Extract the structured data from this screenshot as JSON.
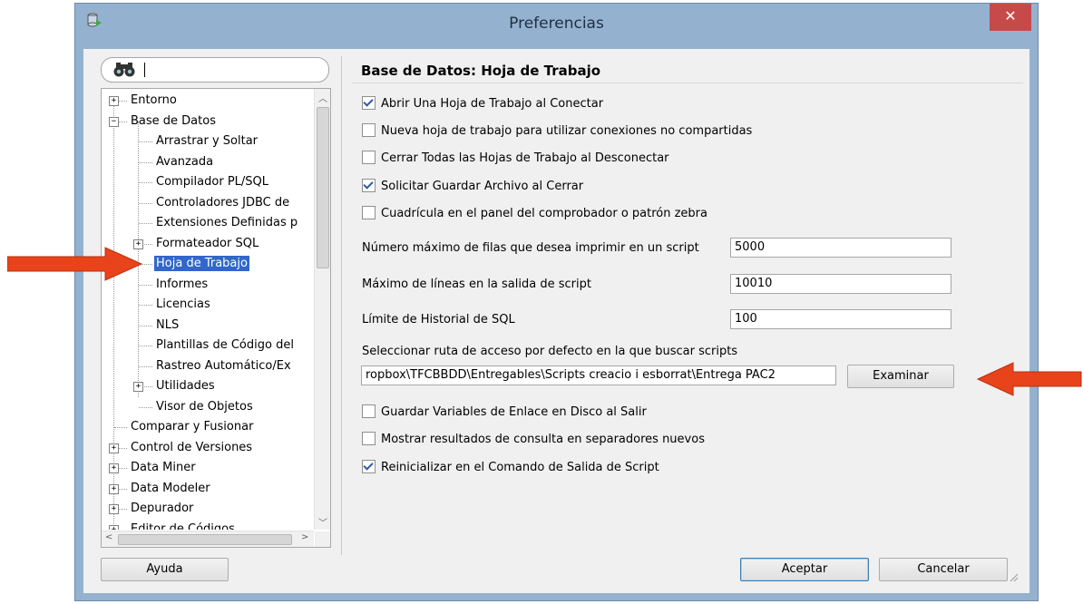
{
  "window": {
    "title": "Preferencias",
    "close_glyph": "✕"
  },
  "search": {
    "value": "",
    "placeholder": ""
  },
  "tree": {
    "items": [
      {
        "label": "Entorno",
        "expander": "+"
      },
      {
        "label": "Base de Datos",
        "expander": "−"
      },
      {
        "label": "Arrastrar y Soltar"
      },
      {
        "label": "Avanzada"
      },
      {
        "label": "Compilador PL/SQL"
      },
      {
        "label": "Controladores JDBC de"
      },
      {
        "label": "Extensiones Definidas p"
      },
      {
        "label": "Formateador SQL",
        "expander": "+"
      },
      {
        "label": "Hoja de Trabajo",
        "selected": true
      },
      {
        "label": "Informes"
      },
      {
        "label": "Licencias"
      },
      {
        "label": "NLS"
      },
      {
        "label": "Plantillas de Código del"
      },
      {
        "label": "Rastreo Automático/Ex"
      },
      {
        "label": "Utilidades",
        "expander": "+"
      },
      {
        "label": "Visor de Objetos"
      },
      {
        "label": "Comparar y Fusionar"
      },
      {
        "label": "Control de Versiones",
        "expander": "+"
      },
      {
        "label": "Data Miner",
        "expander": "+"
      },
      {
        "label": "Data Modeler",
        "expander": "+"
      },
      {
        "label": "Depurador",
        "expander": "+"
      },
      {
        "label": "Editor de Códigos",
        "expander": "+"
      }
    ]
  },
  "main": {
    "title": "Base de Datos: Hoja de Trabajo",
    "checkboxes_top": [
      {
        "label": "Abrir Una Hoja de Trabajo al Conectar",
        "checked": true
      },
      {
        "label": "Nueva hoja de trabajo para utilizar conexiones no compartidas",
        "checked": false
      },
      {
        "label": "Cerrar Todas las Hojas de Trabajo al Desconectar",
        "checked": false
      },
      {
        "label": "Solicitar Guardar Archivo al Cerrar",
        "checked": true
      },
      {
        "label": "Cuadrícula en el panel del comprobador o patrón zebra",
        "checked": false
      }
    ],
    "max_rows_label": "Número máximo de filas que desea imprimir en un script",
    "max_rows_value": "5000",
    "max_lines_label": "Máximo de líneas en la salida de script",
    "max_lines_value": "10010",
    "history_label": "Límite de Historial de SQL",
    "history_value": "100",
    "path_label": "Seleccionar ruta de acceso por defecto en la que buscar scripts",
    "path_value": "ropbox\\TFCBBDD\\Entregables\\Scripts creacio i esborrat\\Entrega PAC2",
    "browse_label": "Examinar",
    "checkboxes_bottom": [
      {
        "label": "Guardar Variables de Enlace en Disco al Salir",
        "checked": false
      },
      {
        "label": "Mostrar resultados de consulta en separadores nuevos",
        "checked": false
      },
      {
        "label": "Reinicializar en el Comando de Salida de Script",
        "checked": true
      }
    ]
  },
  "buttons": {
    "help": "Ayuda",
    "ok": "Aceptar",
    "cancel": "Cancelar"
  },
  "colors": {
    "title_bar": "#94b2cf",
    "close": "#c74a4a",
    "selection": "#3266cc",
    "annotation_arrow": "#e8431b"
  },
  "icons": [
    "app-icon",
    "close-icon",
    "binoculars-icon",
    "checkmark-icon",
    "plus-expander-icon",
    "minus-expander-icon",
    "red-arrow-icon"
  ]
}
